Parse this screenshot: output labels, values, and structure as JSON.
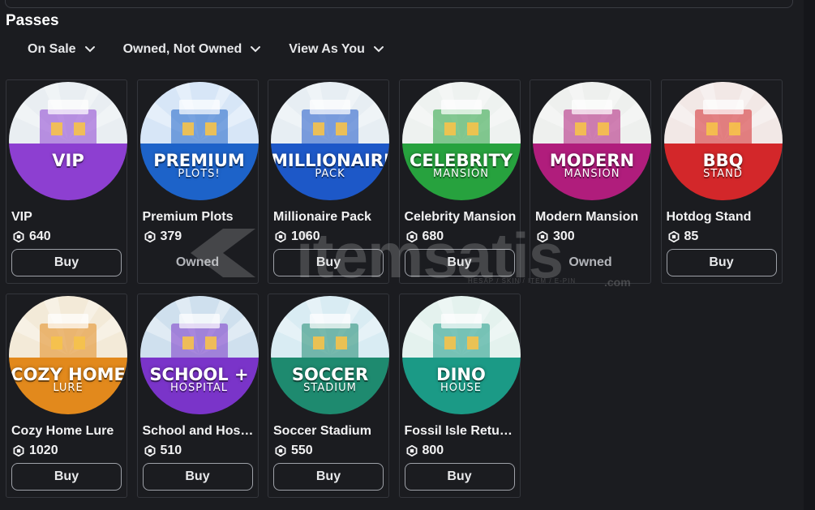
{
  "section": {
    "title": "Passes"
  },
  "filters": [
    {
      "label": "On Sale"
    },
    {
      "label": "Owned, Not Owned"
    },
    {
      "label": "View As You"
    }
  ],
  "passes": [
    {
      "name": "VIP",
      "price": "640",
      "action": "Buy",
      "owned": false,
      "thumb": {
        "line1": "VIP",
        "line2": "",
        "bg": "#8d3fd1",
        "top": "#e9eef2"
      }
    },
    {
      "name": "Premium Plots",
      "price": "379",
      "action": "Owned",
      "owned": true,
      "thumb": {
        "line1": "PREMIUM",
        "line2": "PLOTS!",
        "bg": "#1d63c9",
        "top": "#d7e6f7"
      }
    },
    {
      "name": "Millionaire Pack",
      "price": "1060",
      "action": "Buy",
      "owned": false,
      "thumb": {
        "line1": "MILLIONAIRE",
        "line2": "PACK",
        "bg": "#1d58c8",
        "top": "#e7eef3"
      }
    },
    {
      "name": "Celebrity Mansion",
      "price": "680",
      "action": "Buy",
      "owned": false,
      "thumb": {
        "line1": "CELEBRITY",
        "line2": "MANSION",
        "bg": "#27a23e",
        "top": "#eef2f0"
      }
    },
    {
      "name": "Modern Mansion",
      "price": "300",
      "action": "Owned",
      "owned": true,
      "thumb": {
        "line1": "MODERN",
        "line2": "MANSION",
        "bg": "#b01d7c",
        "top": "#eef0ee"
      }
    },
    {
      "name": "Hotdog Stand",
      "price": "85",
      "action": "Buy",
      "owned": false,
      "thumb": {
        "line1": "BBQ",
        "line2": "STAND",
        "bg": "#d3272a",
        "top": "#f2e8e6"
      }
    },
    {
      "name": "Cozy Home Lure",
      "price": "1020",
      "action": "Buy",
      "owned": false,
      "thumb": {
        "line1": "COZY HOME",
        "line2": "LURE",
        "bg": "#e2891c",
        "top": "#f3ead8"
      }
    },
    {
      "name": "School and Hosp...",
      "price": "510",
      "action": "Buy",
      "owned": false,
      "thumb": {
        "line1": "SCHOOL +",
        "line2": "HOSPITAL",
        "bg": "#7a34c9",
        "top": "#cfe0ee"
      }
    },
    {
      "name": "Soccer Stadium",
      "price": "550",
      "action": "Buy",
      "owned": false,
      "thumb": {
        "line1": "SOCCER",
        "line2": "STADIUM",
        "bg": "#1e8a6f",
        "top": "#d9ecf3"
      }
    },
    {
      "name": "Fossil Isle Return...",
      "price": "800",
      "action": "Buy",
      "owned": false,
      "thumb": {
        "line1": "DINO",
        "line2": "HOUSE",
        "bg": "#1b9a86",
        "top": "#e4f2ee"
      }
    }
  ],
  "watermark": {
    "brand": "itemsatis",
    "tagline": "HESAP / SKIN / ITEM / E-PIN",
    "suffix": ".com"
  },
  "icons": {
    "robux": "robux-icon",
    "chevron": "chevron-down-icon"
  }
}
